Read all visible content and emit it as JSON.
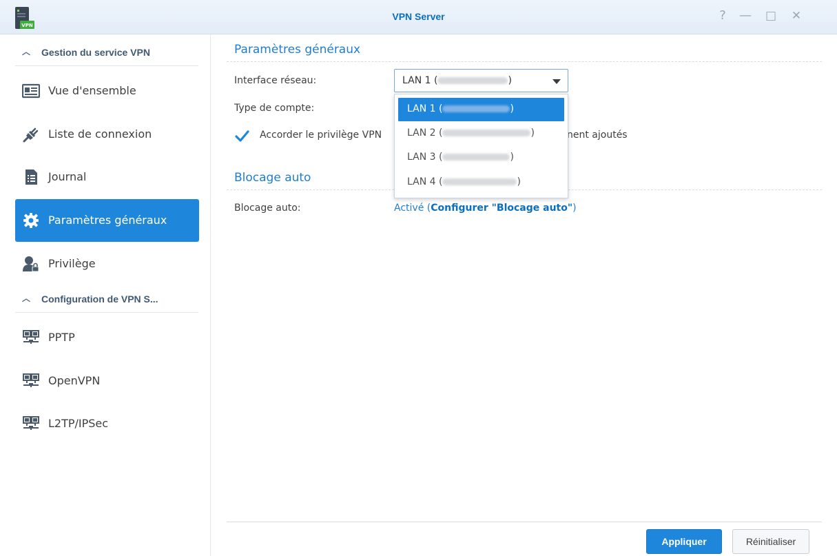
{
  "window": {
    "title": "VPN Server",
    "controls": {
      "help": "?",
      "minimize": "—",
      "maximize": "□",
      "close": "✕"
    }
  },
  "sidebar": {
    "section1": "Gestion du service VPN",
    "items1": [
      {
        "label": "Vue d'ensemble",
        "icon": "overview-card-icon"
      },
      {
        "label": "Liste de connexion",
        "icon": "connection-plug-icon"
      },
      {
        "label": "Journal",
        "icon": "log-document-icon"
      },
      {
        "label": "Paramètres généraux",
        "icon": "gear-icon",
        "active": true
      },
      {
        "label": "Privilège",
        "icon": "user-lock-icon"
      }
    ],
    "section2": "Configuration de VPN S...",
    "items2": [
      {
        "label": "PPTP",
        "icon": "network-icon"
      },
      {
        "label": "OpenVPN",
        "icon": "network-icon"
      },
      {
        "label": "L2TP/IPSec",
        "icon": "network-icon"
      }
    ]
  },
  "general": {
    "title": "Paramètres généraux",
    "interface_label": "Interface réseau:",
    "interface_value_prefix": "LAN 1 (",
    "interface_value_suffix": ")",
    "account_type_label": "Type de compte:",
    "checkbox_label_start": "Accorder le privilège VPN",
    "checkbox_label_end": "nent ajoutés",
    "checkbox_checked": true
  },
  "dropdown": {
    "options": [
      {
        "prefix": "LAN 1 (",
        "suffix": ")",
        "selected": true
      },
      {
        "prefix": "LAN 2 (",
        "suffix": ")",
        "selected": false
      },
      {
        "prefix": "LAN 3 (",
        "suffix": ")",
        "selected": false
      },
      {
        "prefix": "LAN 4 (",
        "suffix": ")",
        "selected": false
      }
    ]
  },
  "autoblock": {
    "title": "Blocage auto",
    "label": "Blocage auto:",
    "status_open": "Activé (",
    "configure_link": "Configurer \"Blocage auto\"",
    "status_close": ")"
  },
  "footer": {
    "apply": "Appliquer",
    "reset": "Réinitialiser"
  },
  "colors": {
    "accent": "#1e87db",
    "title_text": "#0a6fc1",
    "link": "#1f7ed0"
  }
}
